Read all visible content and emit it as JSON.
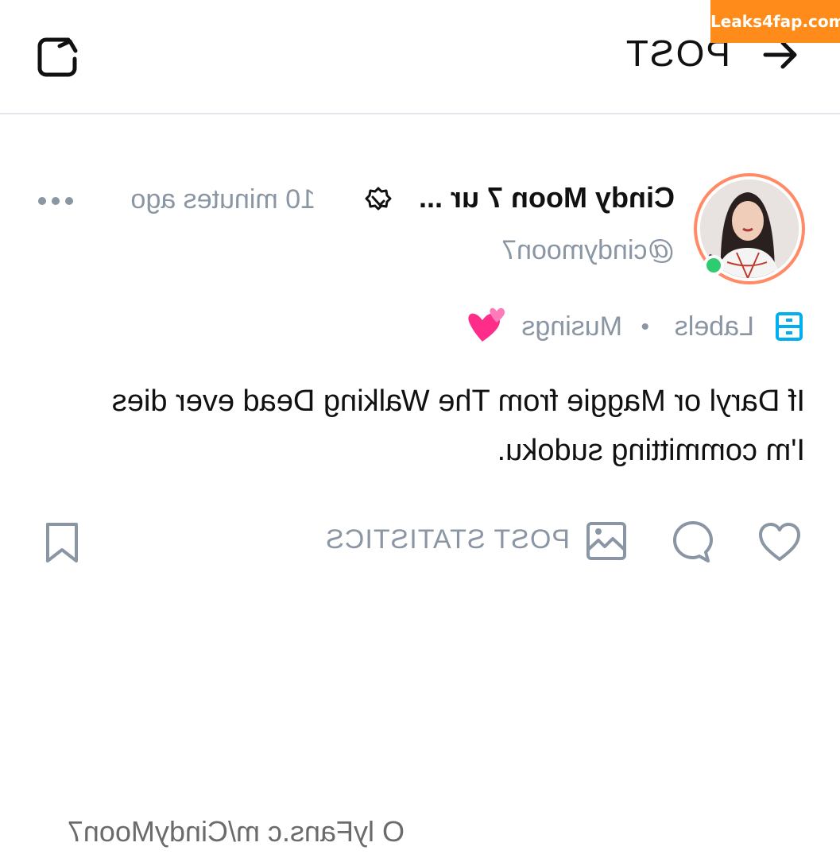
{
  "header": {
    "title": "POST"
  },
  "author": {
    "display_name": "Cindy Moon 7 ur ...",
    "handle": "@cindymoon7",
    "time": "10 minutes ago",
    "online": true
  },
  "labels": {
    "label": "Labels",
    "separator": "•",
    "category": "Musings",
    "emoji": "two-hearts"
  },
  "post": {
    "text": "If Daryl or Maggie from The Walking Dead ever dies I'm committing sudoku."
  },
  "actions": {
    "stats_label": "POST STATISTICS"
  },
  "footer": {
    "url_text": "O lyFans.c m/CindyMoon7"
  },
  "watermark": {
    "text": "Leaks4fap.com"
  },
  "colors": {
    "muted": "#8a96a3",
    "accent_blue": "#00aff0",
    "ring": "#ff8a65",
    "online": "#2ecc71",
    "watermark_bg": "#ff8c1a"
  }
}
